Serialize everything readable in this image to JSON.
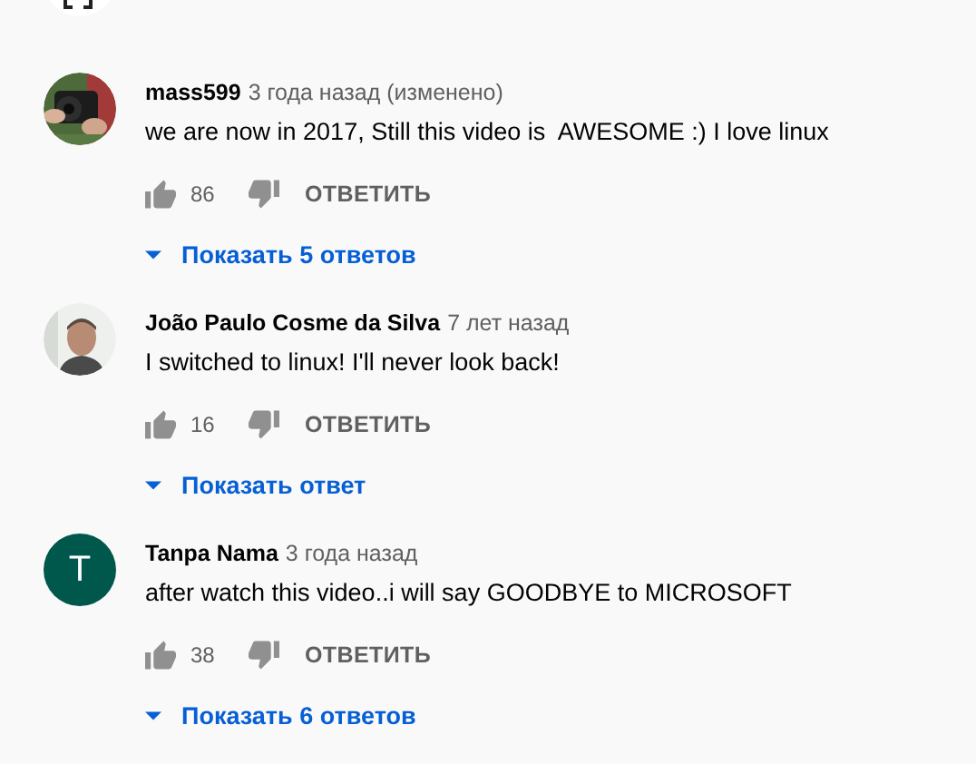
{
  "comments": [
    {
      "author": "mass599",
      "time": "3 года назад (изменено)",
      "text": "we are now in 2017, Still this video is  AWESOME :) I love linux",
      "likes": "86",
      "reply_label": "ОТВЕТИТЬ",
      "replies_label": "Показать 5 ответов"
    },
    {
      "author": "João Paulo Cosme da Silva",
      "time": "7 лет назад",
      "text": "I switched to linux! I'll never look back!",
      "likes": "16",
      "reply_label": "ОТВЕТИТЬ",
      "replies_label": "Показать ответ"
    },
    {
      "author": "Tanpa Nama",
      "time": "3 года назад",
      "text": "after watch this video..i will say GOODBYE to MICROSOFT",
      "likes": "38",
      "reply_label": "ОТВЕТИТЬ",
      "replies_label": "Показать 6 ответов",
      "avatar": {
        "kind": "letter",
        "letter": "T",
        "color": "#00574b"
      }
    }
  ]
}
